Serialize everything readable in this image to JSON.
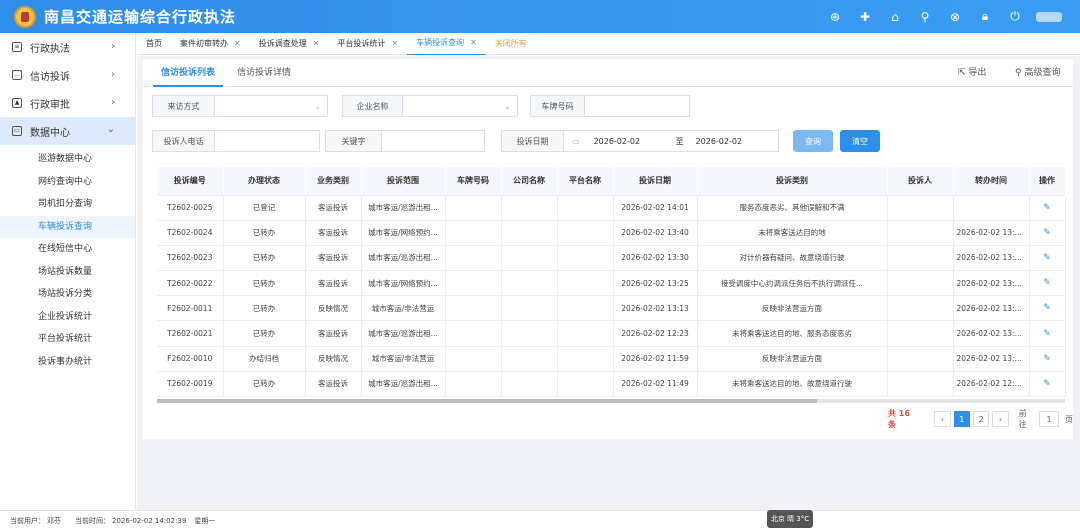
{
  "app": {
    "title": "南昌交通运输综合行政执法",
    "header_icons": [
      "crosshair-icon",
      "plus-icon",
      "home-icon",
      "search-icon",
      "close-circle-icon",
      "lock-icon",
      "power-icon"
    ]
  },
  "sidebar": {
    "menus": [
      {
        "label": "行政执法"
      },
      {
        "label": "信访投诉"
      },
      {
        "label": "行政审批"
      },
      {
        "label": "数据中心"
      }
    ],
    "subitems": [
      "巡游数据中心",
      "网约查询中心",
      "司机扣分查询",
      "车辆投诉查询",
      "在线短信中心",
      "场站投诉数量",
      "场站投诉分类",
      "企业投诉统计",
      "平台投诉统计",
      "投诉事办统计"
    ]
  },
  "tabs": [
    {
      "label": "首页"
    },
    {
      "label": "案件初审转办"
    },
    {
      "label": "投诉调查处理"
    },
    {
      "label": "平台投诉统计"
    },
    {
      "label": "车辆投诉查询"
    },
    {
      "label": "关闭所有"
    }
  ],
  "content": {
    "tabs": [
      "信访投诉列表",
      "信访投诉详情"
    ],
    "export_label": "导出",
    "advanced_label": "高级查询"
  },
  "filters": {
    "source_label": "来访方式",
    "company_label": "企业名称",
    "plate_label": "车牌号码",
    "phone_label": "投诉人电话",
    "keyword_label": "关键字",
    "date_label": "投诉日期",
    "date_from": "2026-02-02",
    "date_sep": "至",
    "date_to": "2026-02-02",
    "search_btn": "查询",
    "clear_btn": "清空"
  },
  "table": {
    "headers": [
      "投诉编号",
      "办理状态",
      "业务类别",
      "投诉范围",
      "车牌号码",
      "公司名称",
      "平台名称",
      "投诉日期",
      "投诉类别",
      "投诉人",
      "转办时间",
      "操作"
    ],
    "rows": [
      [
        "T2602-0025",
        "已登记",
        "客运投诉",
        "城市客运/巡游出租...",
        "",
        "",
        "",
        "2026-02-02 14:01",
        "服务态度恶劣、其他误解和不满",
        "",
        ""
      ],
      [
        "T2602-0024",
        "已转办",
        "客运投诉",
        "城市客运/网络预约...",
        "",
        "",
        "",
        "2026-02-02 13:40",
        "未将乘客送达目的地",
        "",
        "2026-02-02 13:46:.."
      ],
      [
        "T2602-0023",
        "已转办",
        "客运投诉",
        "城市客运/巡游出租...",
        "",
        "",
        "",
        "2026-02-02 13:30",
        "对计价器有疑问、故意绕道行驶",
        "",
        "2026-02-02 13:35:.."
      ],
      [
        "T2602-0022",
        "已转办",
        "客运投诉",
        "城市客运/网络预约...",
        "",
        "",
        "",
        "2026-02-02 13:25",
        "接受调度中心约调派任务后不执行调派任...",
        "",
        "2026-02-02 13:45:.."
      ],
      [
        "F2602-0011",
        "已转办",
        "反映情况",
        "城市客运/非法营运",
        "",
        "",
        "",
        "2026-02-02 13:13",
        "反映非法营运方面",
        "",
        "2026-02-02 13:41:.."
      ],
      [
        "T2602-0021",
        "已转办",
        "客运投诉",
        "城市客运/巡游出租...",
        "",
        "",
        "",
        "2026-02-02 12:23",
        "未将乘客送达目的地、服务态度恶劣",
        "",
        "2026-02-02 13:34:.."
      ],
      [
        "F2602-0010",
        "办结归档",
        "反映情况",
        "城市客运/非法营运",
        "",
        "",
        "",
        "2026-02-02 11:59",
        "反映非法营运方面",
        "",
        "2026-02-02 13:40:.."
      ],
      [
        "T2602-0019",
        "已转办",
        "客运投诉",
        "城市客运/巡游出租...",
        "",
        "",
        "",
        "2026-02-02 11:49",
        "未将乘客送达目的地、故意绕道行驶",
        "",
        "2026-02-02 12:13:.."
      ]
    ]
  },
  "pager": {
    "total": "共 16 条",
    "page1": "1",
    "page2": "2",
    "goto": "前往",
    "page_input": "1",
    "page_unit": "页"
  },
  "status": {
    "user_label": "当前用户：",
    "user": "邓芬",
    "time_label": "当前时间：",
    "time": "2026-02-02 14:02:39",
    "weekday": "星期一"
  },
  "weather": "北京 晴 3°C"
}
